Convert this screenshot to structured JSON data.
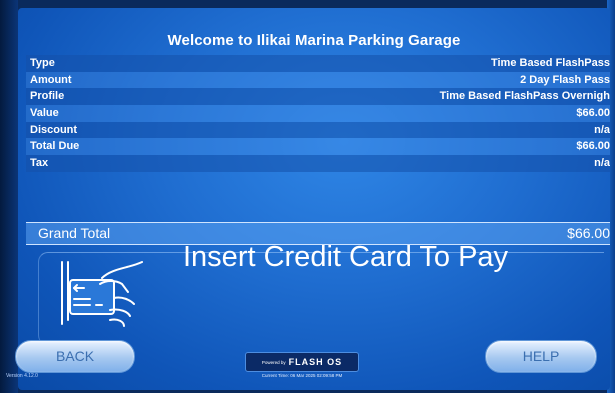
{
  "header": {
    "title": "Welcome to Ilikai Marina Parking Garage"
  },
  "details": [
    {
      "label": "Type",
      "value": "Time Based FlashPass"
    },
    {
      "label": "Amount",
      "value": "2 Day Flash Pass"
    },
    {
      "label": "Profile",
      "value": "Time Based FlashPass Overnigh"
    },
    {
      "label": "Value",
      "value": "$66.00"
    },
    {
      "label": "Discount",
      "value": "n/a"
    },
    {
      "label": "Total Due",
      "value": "$66.00"
    },
    {
      "label": "Tax",
      "value": "n/a"
    }
  ],
  "grand_total": {
    "label": "Grand Total",
    "value": "$66.00"
  },
  "prompt": {
    "text": "Insert Credit Card To Pay",
    "icon": "credit-card-insert-icon"
  },
  "buttons": {
    "back": "BACK",
    "help": "HELP"
  },
  "footer": {
    "powered_by": "Powered by",
    "brand": "FLASH OS",
    "current_time": "Current Time: 06 Mar 2025 02:09:58 PM",
    "version": "Version 4.12.0"
  },
  "colors": {
    "screen_blue": "#1f6dd0",
    "button_face": "#a6c8f0"
  }
}
